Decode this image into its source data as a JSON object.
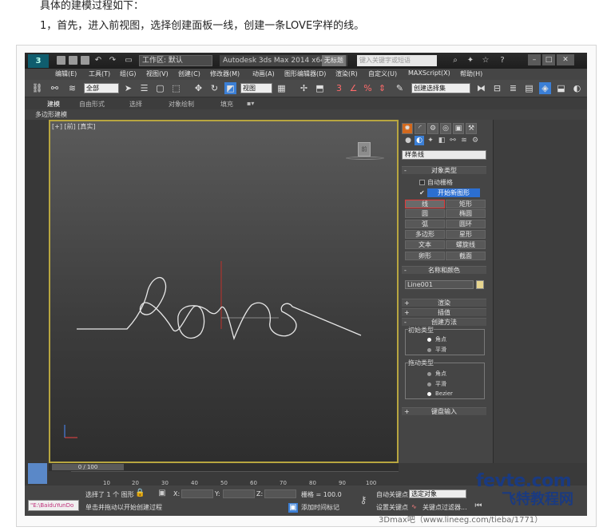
{
  "article": {
    "intro": "具体的建模过程如下：",
    "step1": "1，首先，进入前视图，选择创建面板一线，创建一条LOVE字样的线。"
  },
  "titlebar": {
    "logo": "3",
    "workspace": "工作区: 默认",
    "app_title": "Autodesk 3ds Max 2014 x64",
    "file_tag": "无标题",
    "search_placeholder": "键入关键字或短语",
    "icons": [
      "binoculars-icon",
      "community-icon",
      "star-icon",
      "help-icon"
    ],
    "window_buttons": [
      "minimize-icon",
      "maximize-icon",
      "close-icon"
    ]
  },
  "menubar": {
    "items": [
      "编辑(E)",
      "工具(T)",
      "组(G)",
      "视图(V)",
      "创建(C)",
      "修改器(M)",
      "动画(A)",
      "图形编辑器(D)",
      "渲染(R)",
      "自定义(U)",
      "MAXScript(X)",
      "帮助(H)"
    ]
  },
  "toolbar": {
    "filter_select": "全部",
    "ref_coord_select": "视图",
    "named_selection": "创建选择集"
  },
  "ribbon": {
    "tabs": [
      "建模",
      "自由形式",
      "选择",
      "对象绘制",
      "填充"
    ],
    "subtab": "多边形建模"
  },
  "viewport": {
    "label": "[+] [前] [真实]",
    "cube_label": "前"
  },
  "command_panel": {
    "category": "样条线",
    "rollouts": {
      "object_type": "对象类型",
      "autogrid": "自动栅格",
      "start_new_shape": "开始新图形",
      "buttons": [
        "线",
        "矩形",
        "圆",
        "椭圆",
        "弧",
        "圆环",
        "多边形",
        "星形",
        "文本",
        "螺旋线",
        "卵形",
        "截面"
      ],
      "name_color": "名称和颜色",
      "object_name": "Line001",
      "object_color": "#e7d58f",
      "rendering": "渲染",
      "interpolation": "插值",
      "creation_method": "创建方法",
      "initial_type": "初始类型",
      "initial_options": [
        "角点",
        "平滑"
      ],
      "initial_selected": "角点",
      "drag_type": "拖动类型",
      "drag_options": [
        "角点",
        "平滑",
        "Bezier"
      ],
      "drag_selected": "Bezier",
      "keyboard_entry": "键盘输入"
    }
  },
  "timeline": {
    "slider": "0 / 100",
    "ticks": [
      "10",
      "20",
      "30",
      "40",
      "50",
      "60",
      "70",
      "80",
      "90",
      "100"
    ]
  },
  "statusbar": {
    "selection_info": "选择了 1 个 图形",
    "prompt": "单击并拖动以开始创建过程",
    "x_label": "X:",
    "y_label": "Y:",
    "z_label": "Z:",
    "grid": "栅格 = 100.0",
    "autokey": "自动关键点",
    "setkey": "设置关键点",
    "key_select": "选定对象",
    "key_filter": "关键点过滤器...",
    "add_time_tag": "添加时间标记",
    "listener": "\"E:\\BaiduYunDo"
  },
  "watermark": {
    "brand": "fevte.com",
    "brand_cn": "飞特教程网",
    "credit": "3Dmax吧（www.lineeg.com/tieba/1771）"
  }
}
